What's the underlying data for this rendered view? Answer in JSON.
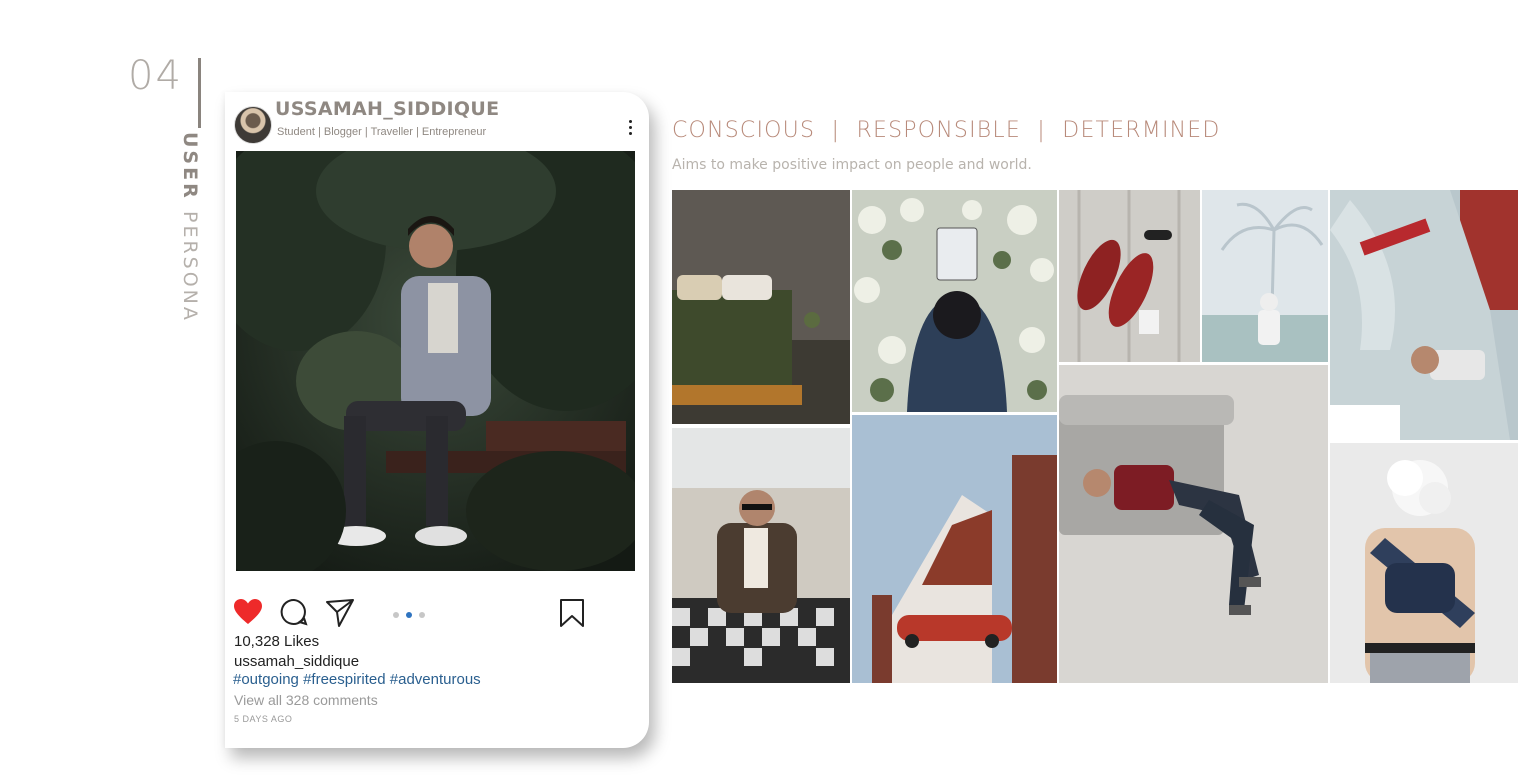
{
  "section": {
    "number": "04",
    "title_bold": "USER",
    "title_light": "PERSONA"
  },
  "post": {
    "username": "USSAMAH_SIDDIQUE",
    "bio": "Student | Blogger | Traveller | Entrepreneur",
    "likes": "10,328 Likes",
    "owner": "ussamah_siddique",
    "hashtags": "#outgoing #freespirited #adventurous",
    "comments": "View all 328 comments",
    "time_ago": "5 DAYS AGO",
    "carousel": {
      "count": 3,
      "active": 2
    },
    "icons": [
      "heart-icon",
      "comment-icon",
      "send-icon",
      "bookmark-icon",
      "more-options-icon"
    ]
  },
  "persona": {
    "headline": "CONSCIOUS  |  RESPONSIBLE  |  DETERMINED",
    "tagline": "Aims to make positive impact on people and world."
  },
  "colors": {
    "heart": "#ee2a2a",
    "hashtag": "#2a5f8f",
    "headline": "#b88a7a",
    "accent_grey": "#8f8882"
  }
}
